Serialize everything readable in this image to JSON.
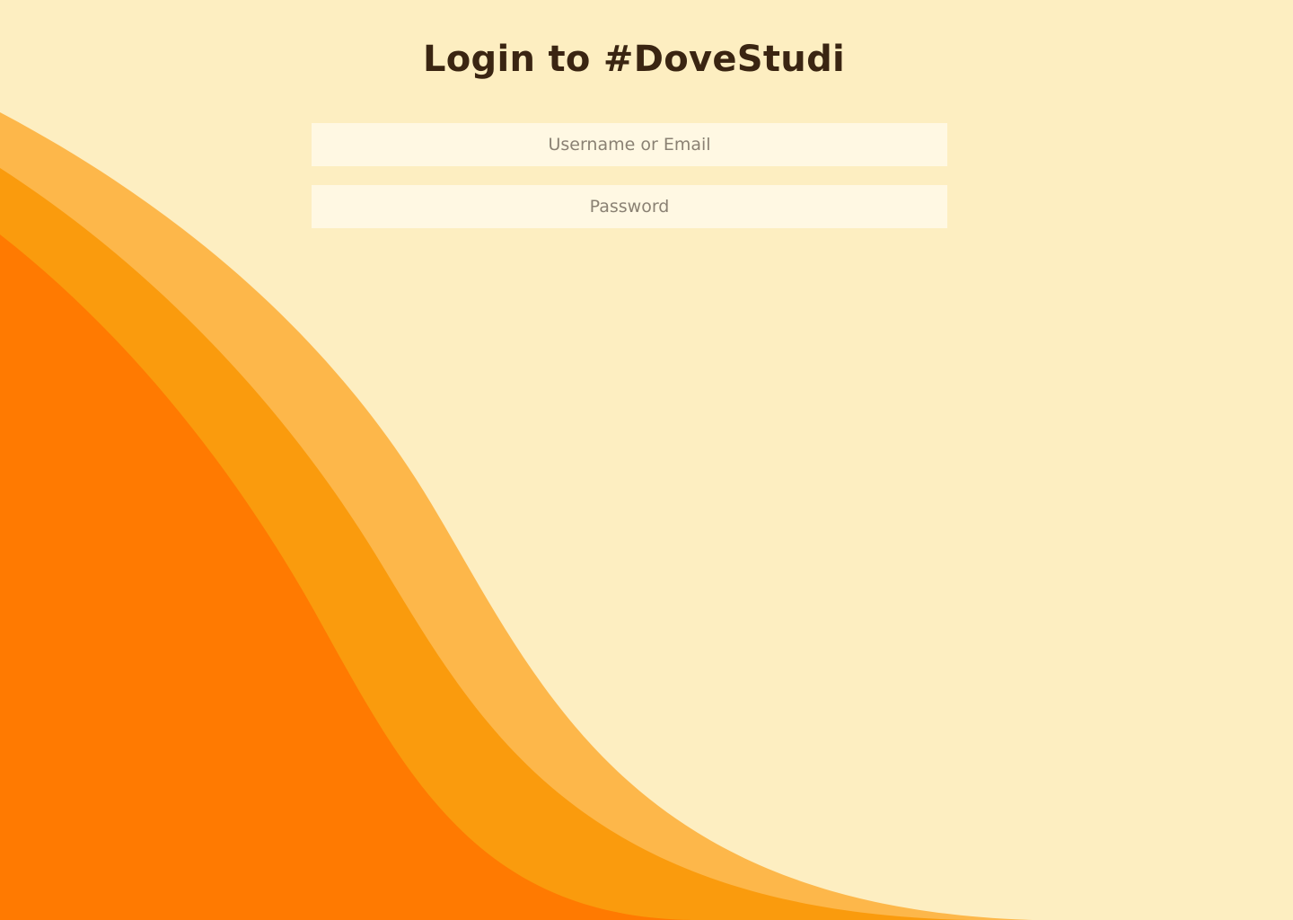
{
  "page": {
    "title": "Login to #DoveStudi"
  },
  "form": {
    "username": {
      "placeholder": "Username or Email",
      "value": ""
    },
    "password": {
      "placeholder": "Password",
      "value": ""
    }
  },
  "colors": {
    "background": "#FDEEC1",
    "wave_light": "#FDB74A",
    "wave_mid": "#FA9B0D",
    "wave_dark": "#FF7A01",
    "title_text": "#3A2512",
    "input_background": "#FFF8E3",
    "placeholder_text": "#8A8173"
  }
}
